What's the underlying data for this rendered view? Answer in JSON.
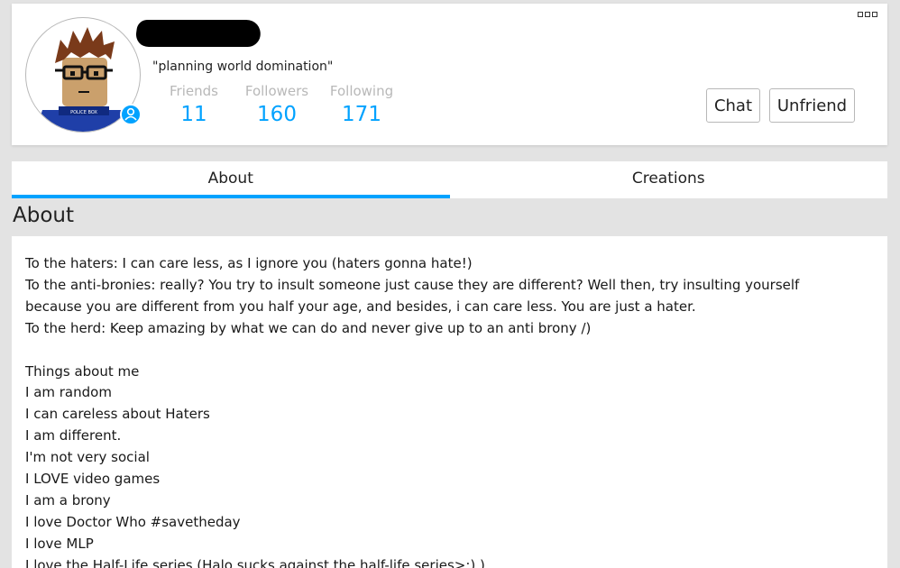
{
  "profile": {
    "status": "\"planning world domination\"",
    "stats": [
      {
        "label": "Friends",
        "value": "11"
      },
      {
        "label": "Followers",
        "value": "160"
      },
      {
        "label": "Following",
        "value": "171"
      }
    ],
    "buttons": {
      "chat": "Chat",
      "unfriend": "Unfriend"
    }
  },
  "tabs": [
    {
      "label": "About",
      "active": true
    },
    {
      "label": "Creations",
      "active": false
    }
  ],
  "about": {
    "title": "About",
    "lines": [
      "To the haters: I can care less, as I ignore you (haters gonna hate!)",
      "To the anti-bronies: really? You try to insult someone just cause they are different? Well then, try insulting yourself",
      "because you are different from you half your age, and besides, i can care less. You are just a hater.",
      "To the herd: Keep amazing by what we can do and never give up to an anti brony /)",
      "",
      "Things about me",
      "I am random",
      "I can careless about Haters",
      "I am different.",
      "I'm not very social",
      "I LOVE video games",
      "I am a brony",
      "I love Doctor Who #savetheday",
      "I love MLP",
      "I love the Half-Life series (Halo sucks against the half-life series>:) )"
    ]
  },
  "colors": {
    "accent": "#00a2ff",
    "background": "#e3e3e3",
    "card": "#ffffff"
  }
}
